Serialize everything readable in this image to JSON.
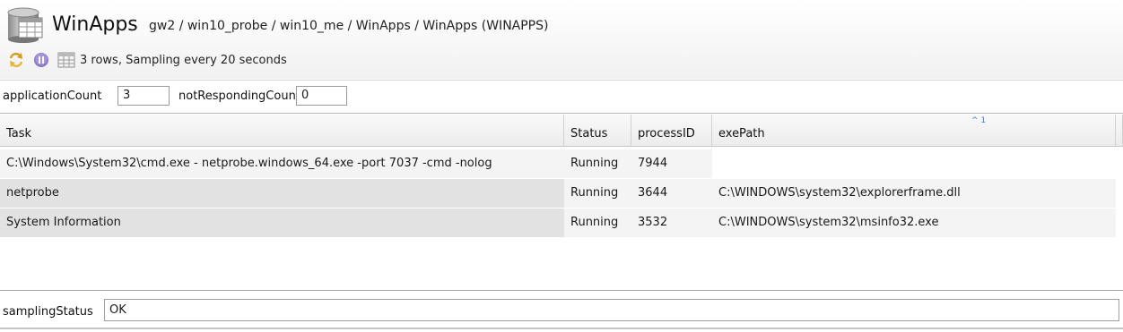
{
  "header": {
    "title": "WinApps",
    "path": "gw2 / win10_probe / win10_me / WinApps / WinApps (WINAPPS)",
    "icon": "database-table-icon"
  },
  "toolbar": {
    "refresh_icon": "refresh-icon",
    "pause_icon": "pause-icon",
    "grid_icon": "grid-icon",
    "status": "3 rows, Sampling every 20 seconds"
  },
  "headlines": [
    {
      "label": "applicationCount",
      "value": "3"
    },
    {
      "label": "notRespondingCount",
      "value": "0"
    }
  ],
  "table": {
    "columns": [
      "Task",
      "Status",
      "processID",
      "exePath"
    ],
    "sort_indicator": "^ 1",
    "rows": [
      {
        "task": "C:\\Windows\\System32\\cmd.exe - netprobe.windows_64.exe  -port 7037 -cmd -nolog",
        "status": "Running",
        "pid": "7944",
        "path": ""
      },
      {
        "task": "netprobe",
        "status": "Running",
        "pid": "3644",
        "path": "C:\\WINDOWS\\system32\\explorerframe.dll"
      },
      {
        "task": "System Information",
        "status": "Running",
        "pid": "3532",
        "path": "C:\\WINDOWS\\system32\\msinfo32.exe"
      }
    ]
  },
  "sampling": {
    "label": "samplingStatus",
    "value": "OK"
  },
  "colors": {
    "row_alt": "#e2e2e2",
    "row_base": "#f4f4f4",
    "header_grad_top": "#f9f9f9",
    "header_grad_bottom": "#ececec",
    "sort_arrow": "#3a7bd5"
  }
}
